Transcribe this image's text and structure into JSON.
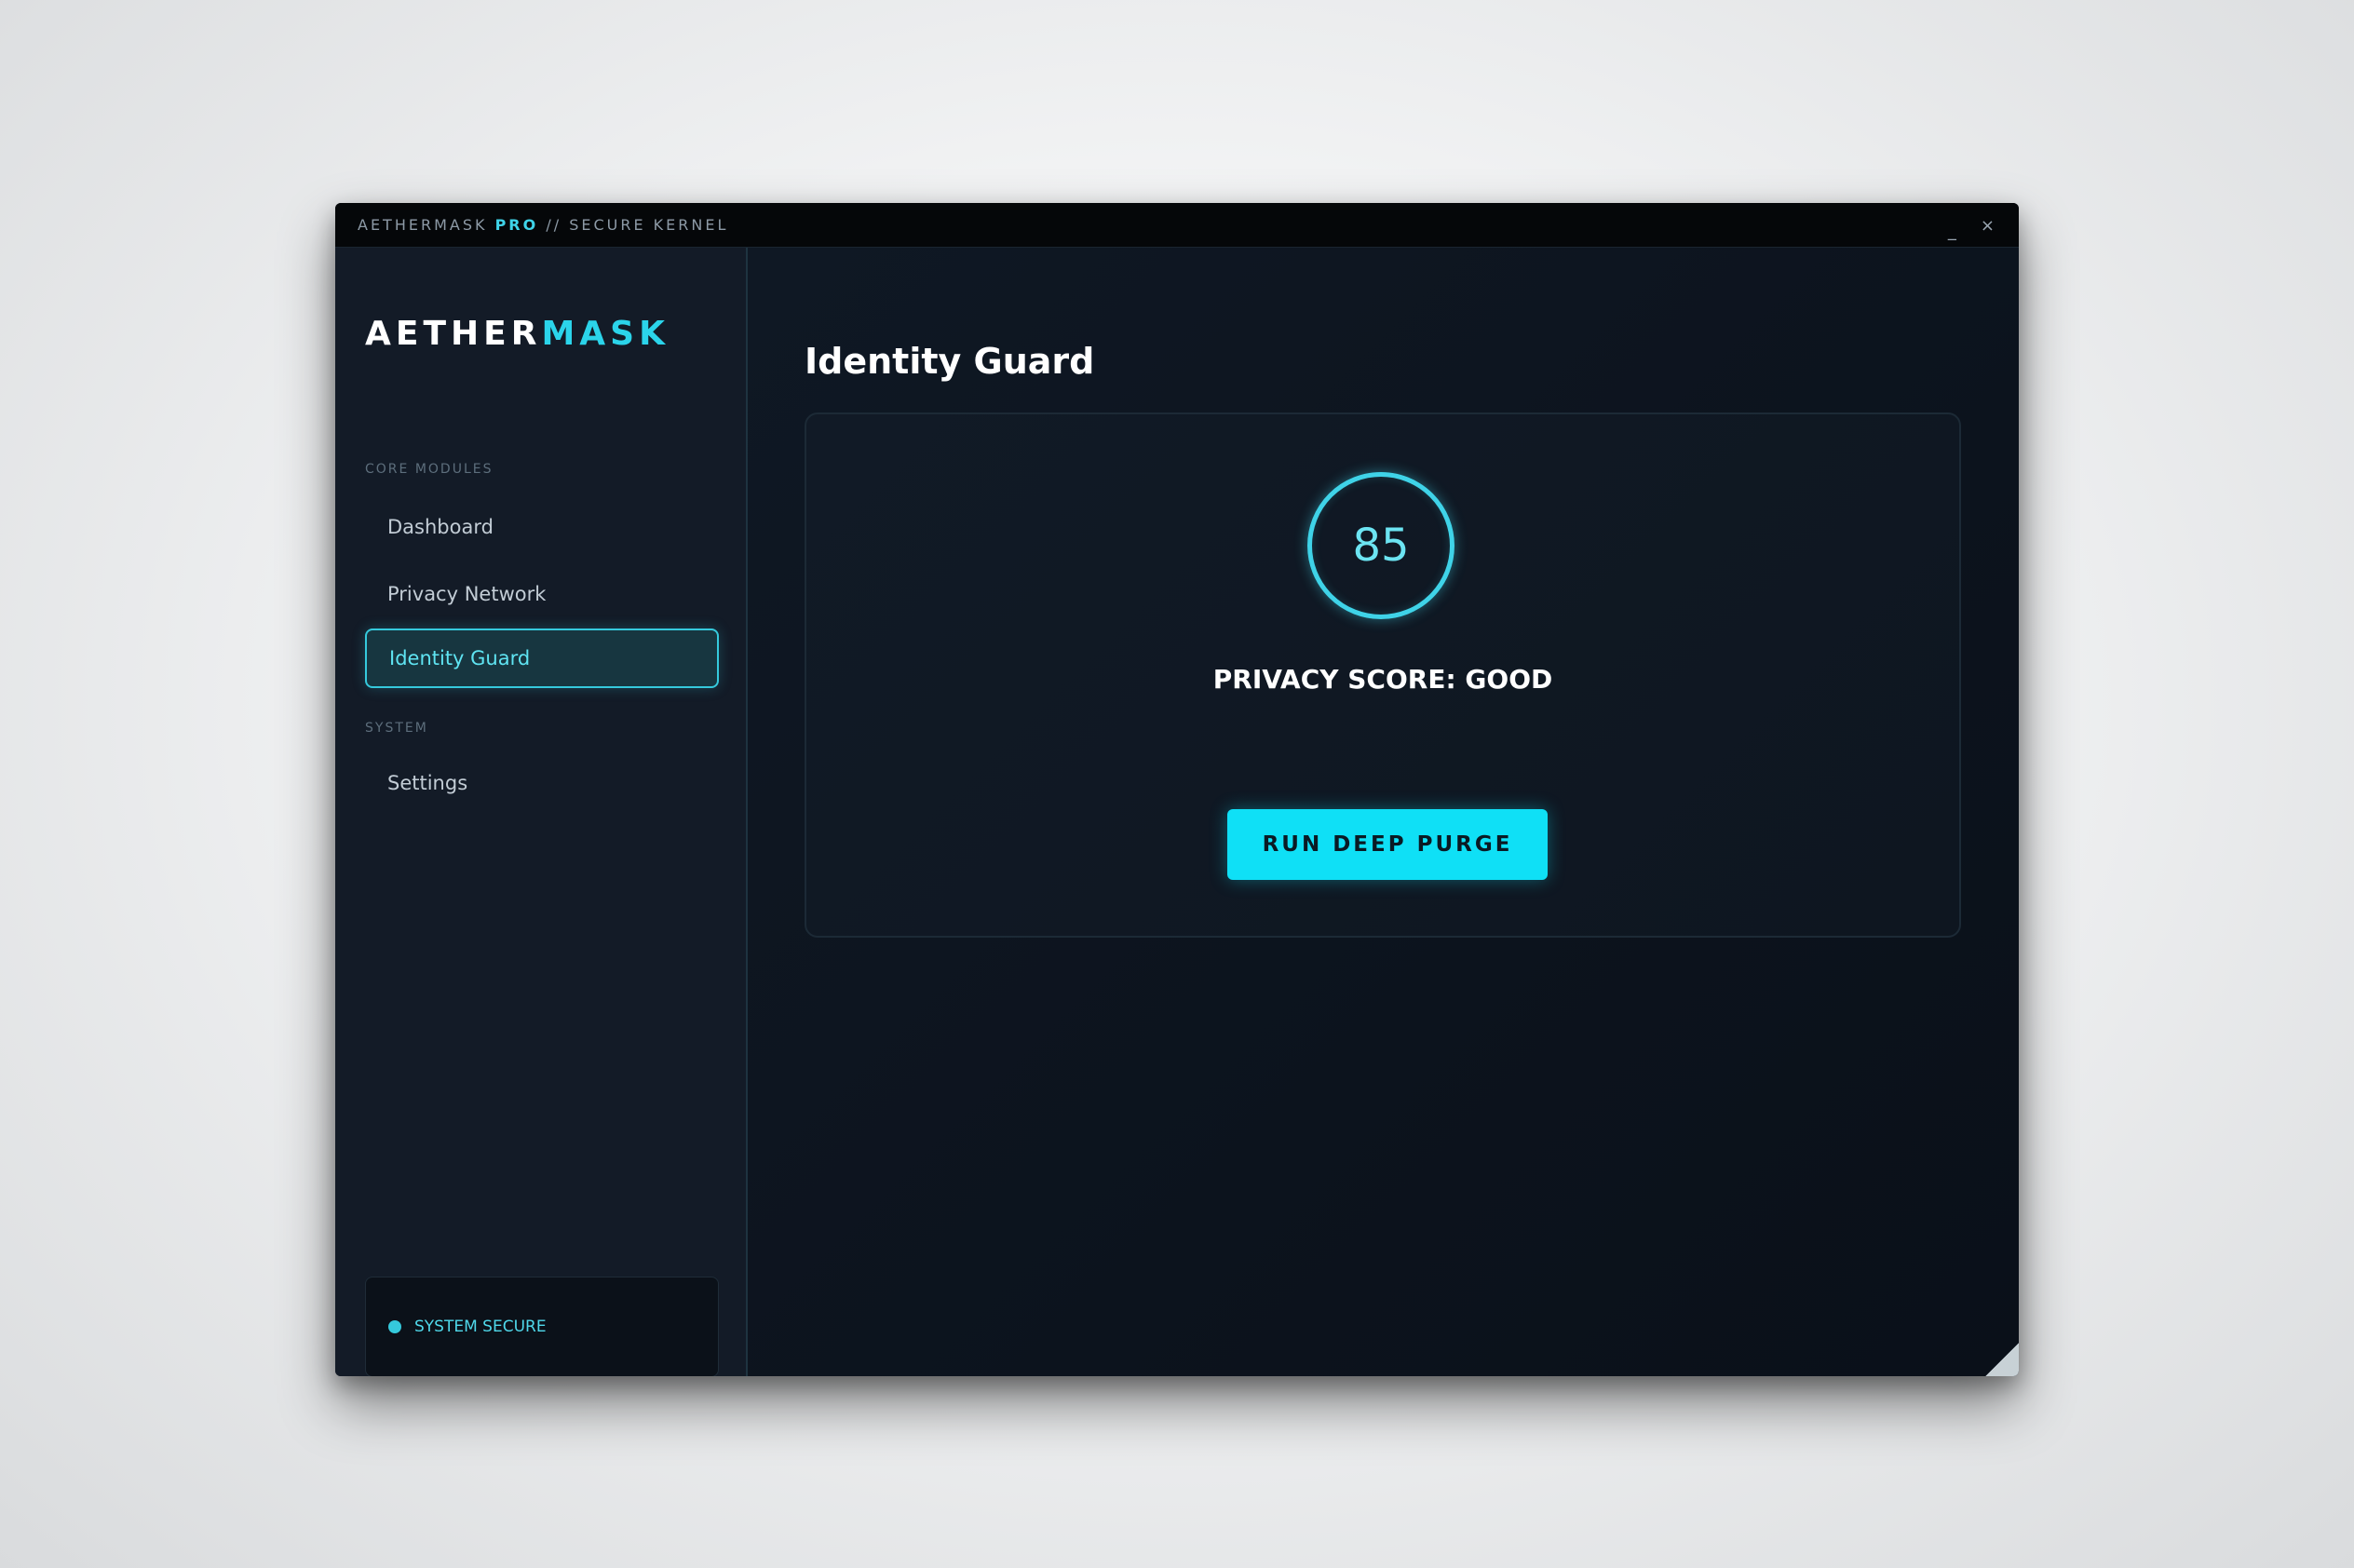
{
  "window": {
    "title_brand": "AETHERMASK",
    "title_pro": "PRO",
    "title_suffix": "// SECURE KERNEL",
    "minimize_label": "_",
    "close_label": "×"
  },
  "sidebar": {
    "logo_part1": "AETHER",
    "logo_part2": "MASK",
    "sections": [
      {
        "label": "CORE MODULES",
        "items": [
          {
            "label": "Dashboard",
            "active": false
          },
          {
            "label": "Privacy Network",
            "active": false
          },
          {
            "label": "Identity Guard",
            "active": true
          }
        ]
      },
      {
        "label": "SYSTEM",
        "items": [
          {
            "label": "Settings",
            "active": false
          }
        ]
      }
    ],
    "status": {
      "text": "SYSTEM SECURE",
      "color": "#35c9dc"
    }
  },
  "main": {
    "title": "Identity Guard",
    "score": {
      "value": "85",
      "label": "PRIVACY SCORE: GOOD"
    },
    "action_button": "RUN DEEP PURGE"
  },
  "colors": {
    "accent": "#2bd4ea",
    "button": "#0fe0f6",
    "window_bg": "#0d1520",
    "sidebar_bg": "#131b27"
  }
}
